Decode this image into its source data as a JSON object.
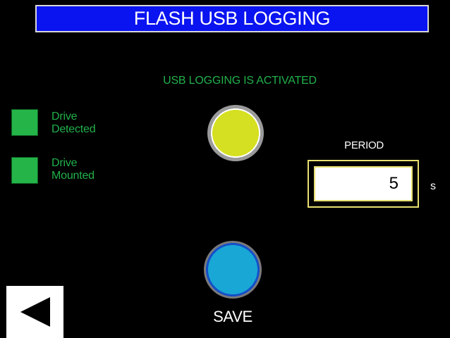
{
  "header": {
    "title": "FLASH USB LOGGING"
  },
  "status": {
    "message": "USB LOGGING IS ACTIVATED",
    "lamp_color": "#d6e022"
  },
  "indicators": [
    {
      "line1": "Drive",
      "line2": "Detected",
      "color": "#24b448"
    },
    {
      "line1": "Drive",
      "line2": "Mounted",
      "color": "#24b448"
    }
  ],
  "period": {
    "label": "PERIOD",
    "value": "5",
    "unit": "s"
  },
  "save": {
    "label": "SAVE"
  },
  "nav": {
    "back_icon": "left-arrow-icon"
  },
  "colors": {
    "header_bg": "#0a14f0",
    "accent_green": "#22b04b",
    "field_border": "#e8e070",
    "save_button": "#19a7d6"
  }
}
